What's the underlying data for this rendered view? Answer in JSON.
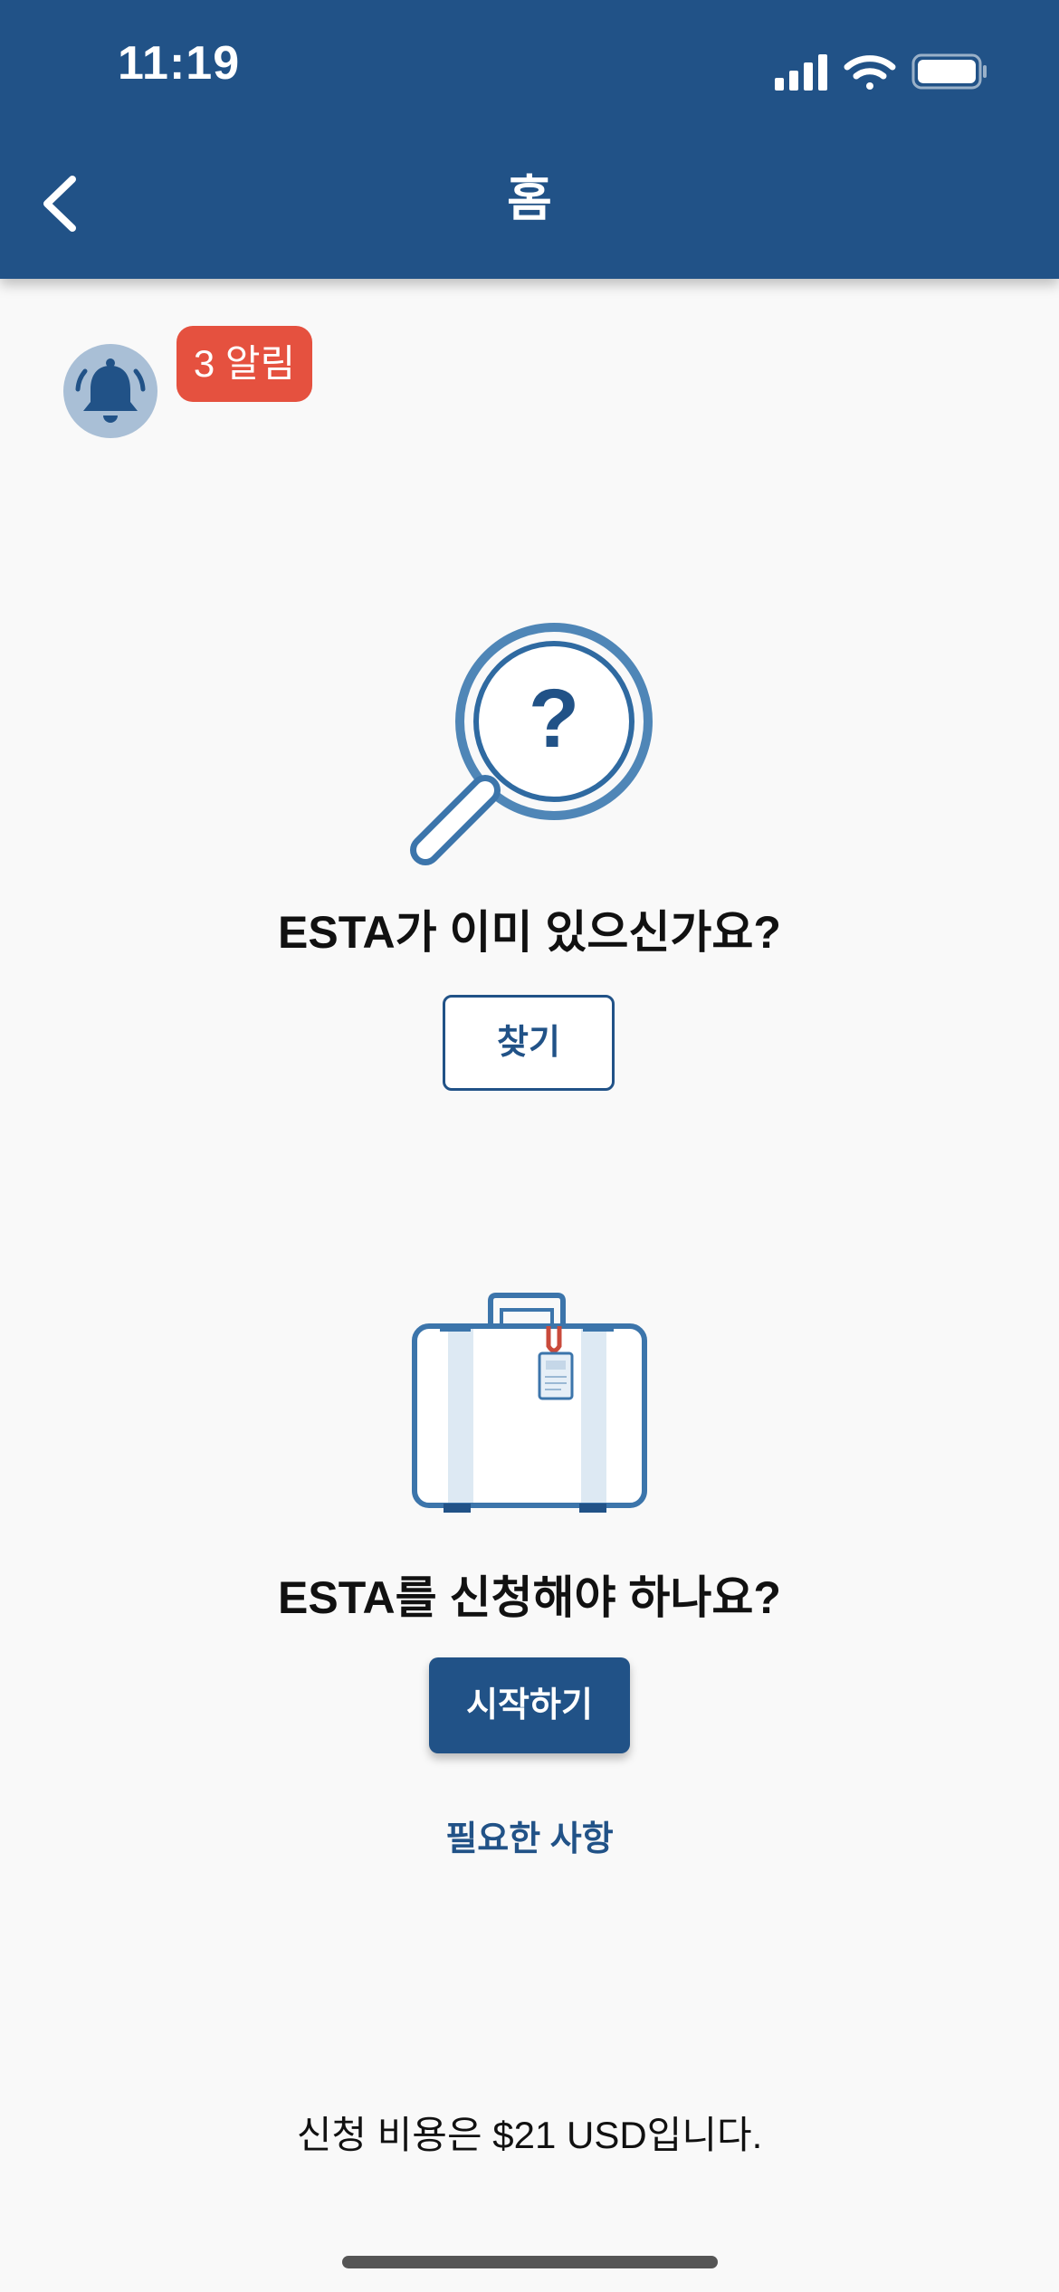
{
  "status_bar": {
    "time": "11:19",
    "icons": [
      "signal-icon",
      "wifi-icon",
      "battery-icon"
    ]
  },
  "nav": {
    "back_icon": "chevron-left-icon",
    "title": "홈"
  },
  "notifications": {
    "icon": "bell-icon",
    "badge_label": "3 알림"
  },
  "lookup_section": {
    "illustration": "magnifier-question-icon",
    "heading": "ESTA가 이미 있으신가요?",
    "button_label": "찾기"
  },
  "apply_section": {
    "illustration": "suitcase-icon",
    "heading": "ESTA를 신청해야 하나요?",
    "button_label": "시작하기",
    "requirements_link": "필요한 사항"
  },
  "footer": {
    "fee_text": "신청 비용은 $21 USD입니다."
  },
  "colors": {
    "primary": "#215287",
    "badge": "#e5513f",
    "background": "#f9f9f9"
  }
}
